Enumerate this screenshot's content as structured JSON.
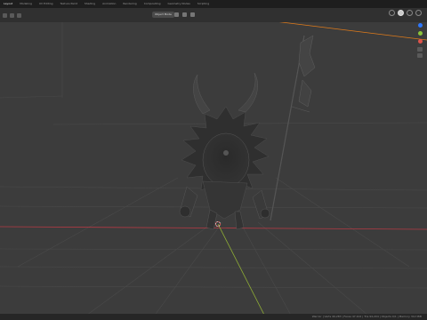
{
  "workspace_tabs": [
    "Layout",
    "Modeling",
    "UV Editing",
    "Texture Paint",
    "Shading",
    "Animation",
    "Rendering",
    "Compositing",
    "Geometry Nodes",
    "Scripting"
  ],
  "viewport": {
    "mode_label": "Object Mode",
    "header_icons": [
      "view-menu-icon",
      "select-menu-icon",
      "add-menu-icon"
    ]
  },
  "shading_icons": [
    "wireframe-icon",
    "solid-icon",
    "material-icon",
    "rendered-icon"
  ],
  "gizmo_axes": [
    "Z",
    "Y",
    "X"
  ],
  "colors": {
    "axis_x": "#c4404a",
    "axis_y": "#8fae35",
    "axis_z": "#2e78ff",
    "selection_orange": "#e07b1a"
  },
  "statusbar": {
    "text": "Warrior | Verts 49,283 | Faces 47,102 | Tris 94,204 | Objects 0/1 | Memory 312 MiB"
  }
}
